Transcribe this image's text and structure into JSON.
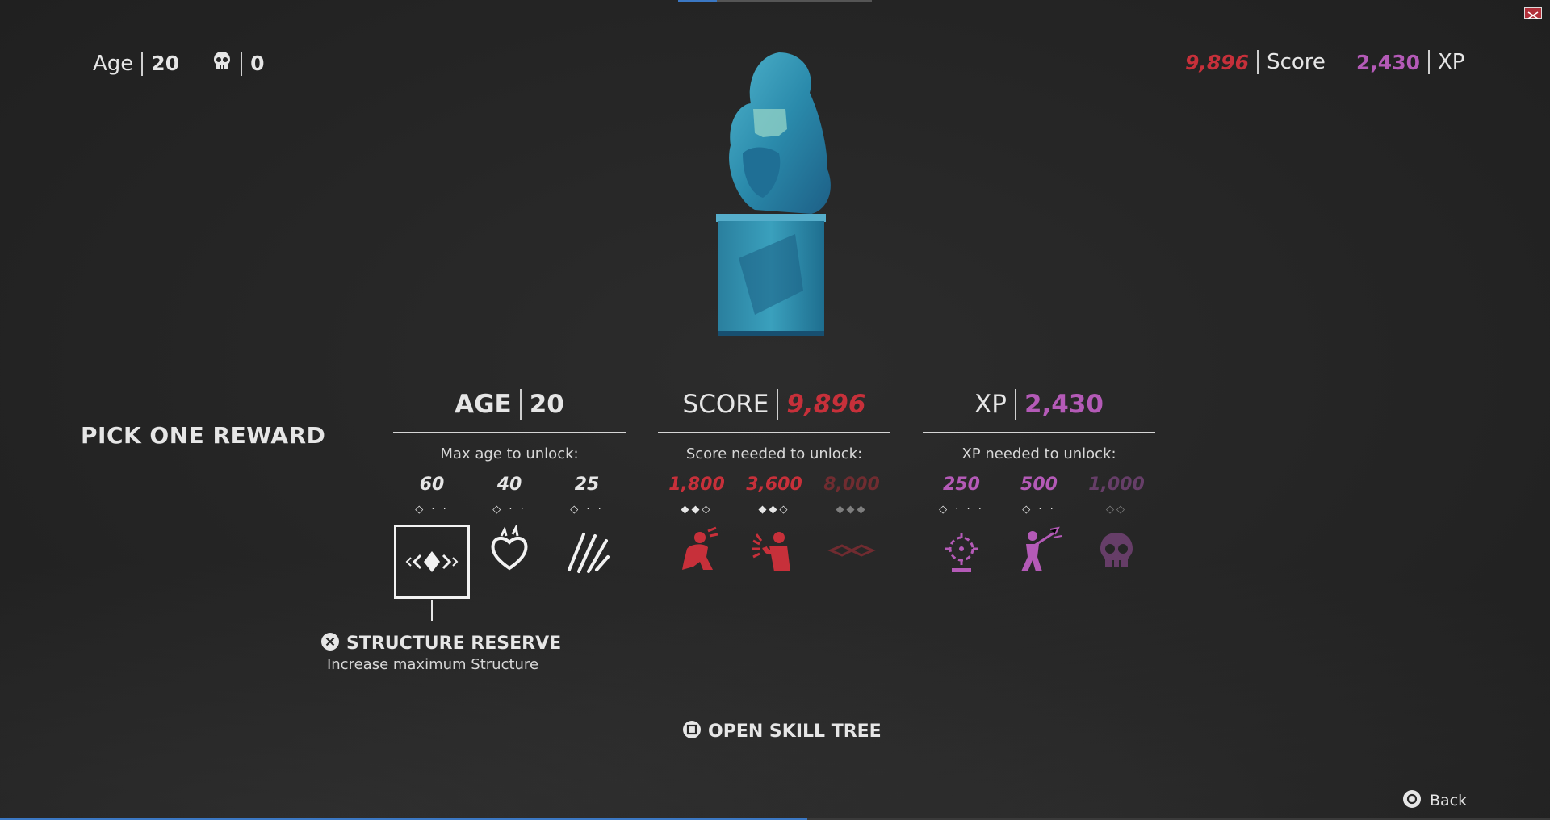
{
  "hud": {
    "age_label": "Age",
    "age_value": "20",
    "kills_icon": "skull-icon",
    "kills_value": "0",
    "score_value": "9,896",
    "score_label": "Score",
    "xp_value": "2,430",
    "xp_label": "XP"
  },
  "title": "PICK ONE REWARD",
  "columns": {
    "age": {
      "label": "AGE",
      "value": "20",
      "subtitle": "Max age to unlock:",
      "rewards": [
        {
          "threshold": "60",
          "pips": "◇ · ·",
          "icon": "structure-icon",
          "selected": true
        },
        {
          "threshold": "40",
          "pips": "◇ · ·",
          "icon": "heart-flame-icon"
        },
        {
          "threshold": "25",
          "pips": "◇ · ·",
          "icon": "slash-strikes-icon"
        }
      ]
    },
    "score": {
      "label": "SCORE",
      "value": "9,896",
      "subtitle": "Score needed to unlock:",
      "rewards": [
        {
          "threshold": "1,800",
          "pips": "◆◆◇",
          "icon": "crouching-fighter-icon"
        },
        {
          "threshold": "3,600",
          "pips": "◆◆◇",
          "icon": "punch-impact-icon"
        },
        {
          "threshold": "8,000",
          "pips": "◆◆◆",
          "icon": "locked-emblem-icon",
          "locked": true
        }
      ]
    },
    "xp": {
      "label": "XP",
      "value": "2,430",
      "subtitle": "XP needed to unlock:",
      "rewards": [
        {
          "threshold": "250",
          "pips": "◇ · · ·",
          "icon": "target-reticle-icon"
        },
        {
          "threshold": "500",
          "pips": "◇ · ·",
          "icon": "staff-fighter-icon"
        },
        {
          "threshold": "1,000",
          "pips": "◇◇",
          "icon": "skull-icon",
          "locked": true
        }
      ]
    }
  },
  "selected_reward": {
    "button_icon": "cross-button-icon",
    "name": "STRUCTURE RESERVE",
    "description": "Increase maximum Structure"
  },
  "skill_tree": {
    "button_icon": "square-button-icon",
    "label": "OPEN SKILL TREE"
  },
  "back": {
    "button_icon": "circle-button-icon",
    "label": "Back"
  },
  "colors": {
    "score": "#c7303a",
    "xp": "#b45ab7",
    "statue": "#2f8fb0",
    "progress": "#3b78c4"
  }
}
